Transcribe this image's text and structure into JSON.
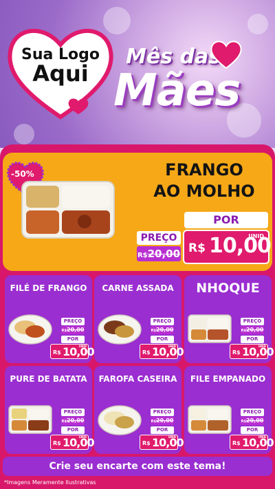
{
  "header": {
    "logo_line1": "Sua Logo",
    "logo_line2": "Aqui",
    "title_top": "Mês das",
    "title_main": "Mães"
  },
  "featured": {
    "discount_badge": "-50%",
    "name_line1": "FRANGO",
    "name_line2": "AO MOLHO",
    "preco_label": "PREÇO",
    "old_currency": "R$",
    "old_price": "20,00",
    "por_label": "POR",
    "currency": "R$",
    "new_price": "10,00",
    "unit": "UNID"
  },
  "products": [
    {
      "name": "FILÉ DE FRANGO",
      "preco_label": "PREÇO",
      "old_currency": "R$",
      "old_price": "20,00",
      "por_label": "POR",
      "currency": "R$",
      "new_price": "10,00",
      "unit": "UNID"
    },
    {
      "name": "CARNE ASSADA",
      "preco_label": "PREÇO",
      "old_currency": "R$",
      "old_price": "20,00",
      "por_label": "POR",
      "currency": "R$",
      "new_price": "10,00",
      "unit": "UNID"
    },
    {
      "name": "NHOQUE",
      "preco_label": "PREÇO",
      "old_currency": "R$",
      "old_price": "20,00",
      "por_label": "POR",
      "currency": "R$",
      "new_price": "10,00",
      "unit": "UNID"
    },
    {
      "name": "PURE DE BATATA",
      "preco_label": "PREÇO",
      "old_currency": "R$",
      "old_price": "20,00",
      "por_label": "POR",
      "currency": "R$",
      "new_price": "10,00",
      "unit": "UNID"
    },
    {
      "name": "FAROFA CASEIRA",
      "preco_label": "PREÇO",
      "old_currency": "R$",
      "old_price": "20,00",
      "por_label": "POR",
      "currency": "R$",
      "new_price": "10,00",
      "unit": "UNID"
    },
    {
      "name": "FILE EMPANADO",
      "preco_label": "PREÇO",
      "old_currency": "R$",
      "old_price": "20,00",
      "por_label": "POR",
      "currency": "R$",
      "new_price": "10,00",
      "unit": "UNID"
    }
  ],
  "footer": {
    "cta": "Crie seu encarte com este tema!",
    "disclaimer": "*Imagens Meramente Ilustrativas"
  },
  "colors": {
    "magenta": "#d8176a",
    "purple": "#9a2ed0",
    "orange": "#f6a817",
    "price_red": "#e01a6c"
  }
}
